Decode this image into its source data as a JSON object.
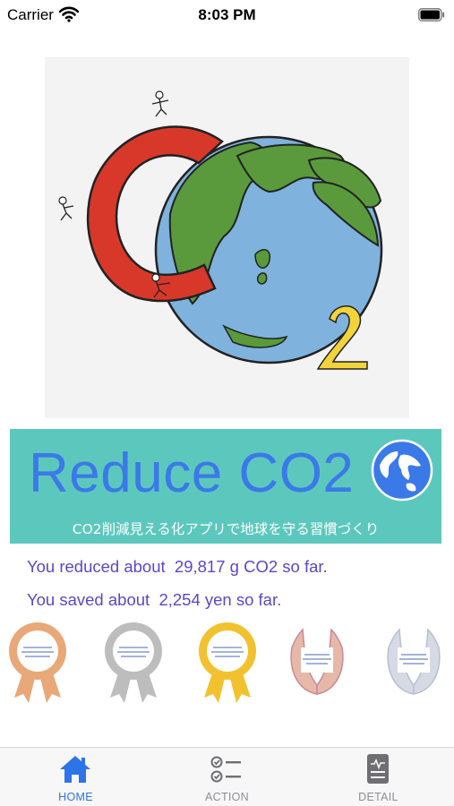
{
  "status_bar": {
    "carrier": "Carrier",
    "time": "8:03 PM"
  },
  "banner": {
    "title": "Reduce CO2",
    "subtitle": "CO2削減見える化アプリで地球を守る習慣づくり",
    "background_color": "#5cc8bd",
    "title_color": "#3b79e8"
  },
  "stats": {
    "reduced": "You reduced about  29,817 g CO2 so far.",
    "saved": "You saved about  2,254 yen so far.",
    "text_color": "#5a48c8"
  },
  "badges": [
    {
      "name": "bronze-rosette-icon",
      "color": "#e8a878"
    },
    {
      "name": "silver-rosette-icon",
      "color": "#bdbdbd"
    },
    {
      "name": "gold-rosette-icon",
      "color": "#f2c12e"
    },
    {
      "name": "bronze-laurel-icon",
      "color": "#c98a9a"
    },
    {
      "name": "silver-laurel-icon",
      "color": "#b8bfd0"
    }
  ],
  "tabs": [
    {
      "label": "HOME",
      "icon": "home-icon",
      "active": true
    },
    {
      "label": "ACTION",
      "icon": "checklist-icon",
      "active": false
    },
    {
      "label": "DETAIL",
      "icon": "document-icon",
      "active": false
    }
  ],
  "colors": {
    "accent": "#2d74e8",
    "inactive": "#8e8e93"
  }
}
